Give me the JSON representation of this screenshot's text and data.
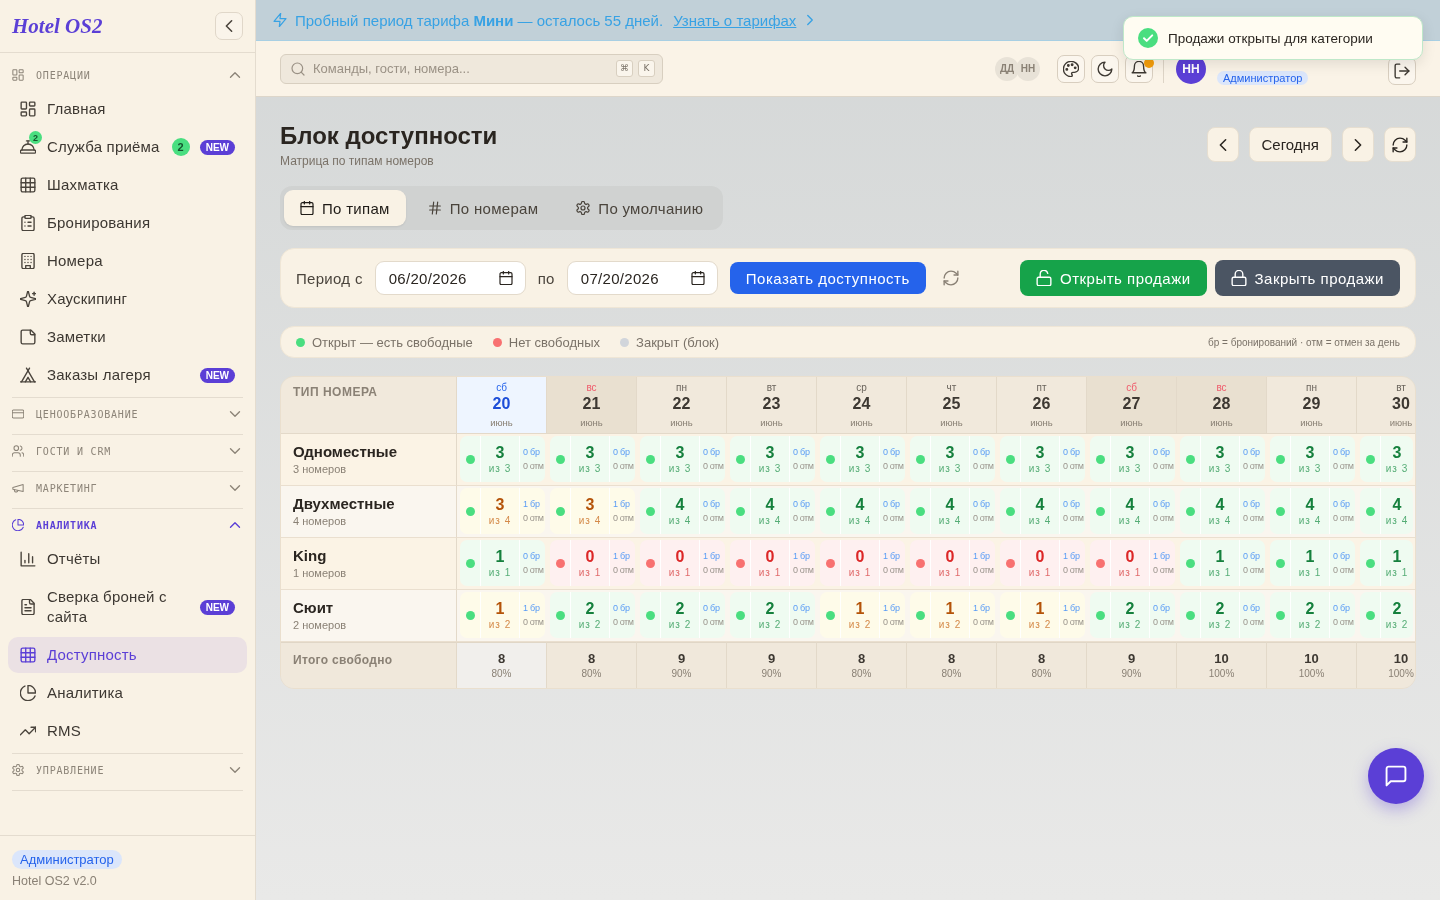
{
  "sidebar": {
    "logo": "Hotel OS2",
    "sections": [
      {
        "label": "ОПЕРАЦИИ",
        "expanded": true,
        "active": false,
        "items": [
          {
            "label": "Главная",
            "selected": false
          },
          {
            "label": "Служба приёма",
            "selected": false,
            "icon_badge": "2",
            "count": "2",
            "tag": "NEW"
          },
          {
            "label": "Шахматка",
            "selected": false
          },
          {
            "label": "Бронирования",
            "selected": false
          },
          {
            "label": "Номера",
            "selected": false
          },
          {
            "label": "Хаускипинг",
            "selected": false
          },
          {
            "label": "Заметки",
            "selected": false
          },
          {
            "label": "Заказы лагеря",
            "selected": false,
            "tag": "NEW"
          }
        ]
      },
      {
        "label": "ЦЕНООБРАЗОВАНИЕ",
        "expanded": false,
        "active": false
      },
      {
        "label": "ГОСТИ И CRM",
        "expanded": false,
        "active": false
      },
      {
        "label": "МАРКЕТИНГ",
        "expanded": false,
        "active": false
      },
      {
        "label": "АНАЛИТИКА",
        "expanded": true,
        "active": true,
        "items": [
          {
            "label": "Отчёты",
            "selected": false
          },
          {
            "label": "Сверка броней с сайта",
            "selected": false,
            "tag": "NEW"
          },
          {
            "label": "Доступность",
            "selected": true
          },
          {
            "label": "Аналитика",
            "selected": false
          },
          {
            "label": "RMS",
            "selected": false
          }
        ]
      },
      {
        "label": "УПРАВЛЕНИЕ",
        "expanded": false,
        "active": false
      }
    ],
    "footer": {
      "role": "Администратор",
      "version": "Hotel OS2 v2.0"
    }
  },
  "banner": {
    "text": "Пробный период тарифа **Мини** — осталось 55 дней.",
    "link": "Узнать о тарифах"
  },
  "topbar": {
    "search": {
      "placeholder": "Команды, гости, номера...",
      "shortcut": [
        "⌘",
        "K"
      ]
    },
    "online_users": [
      "ДД",
      "НН"
    ],
    "notifications": {
      "unread": true
    },
    "user": {
      "initials": "НН",
      "role": "Администратор"
    }
  },
  "toast": {
    "message": "Продажи открыты для категории"
  },
  "page": {
    "title": "Блок доступности",
    "subtitle": "Матрица по типам номеров",
    "today_button": "Сегодня"
  },
  "view_tabs": [
    {
      "label": "По типам",
      "selected": true
    },
    {
      "label": "По номерам",
      "selected": false
    },
    {
      "label": "По умолчанию",
      "selected": false
    }
  ],
  "filters": {
    "from_label": "Период с",
    "from": "06/20/2026",
    "to_label": "по",
    "to": "07/20/2026",
    "show_button": "Показать доступность",
    "actions": [
      {
        "kind": "open",
        "label": "Открыть продажи"
      },
      {
        "kind": "close",
        "label": "Закрыть продажи"
      }
    ]
  },
  "legend": {
    "items": [
      {
        "label": "Открыт — есть свободные",
        "color": "#4ade80"
      },
      {
        "label": "Нет свободных",
        "color": "#f87171"
      },
      {
        "label": "Закрыт (блок)",
        "color": "#d1d5db"
      }
    ],
    "note": "бр = бронирований · отм = отмен за день"
  },
  "table": {
    "type_header": "ТИП НОМЕРА",
    "columns": [
      {
        "weekday": "сб",
        "day": "20",
        "month": "июнь",
        "weekend": true,
        "today": true
      },
      {
        "weekday": "вс",
        "day": "21",
        "month": "июнь",
        "weekend": true,
        "today": false
      },
      {
        "weekday": "пн",
        "day": "22",
        "month": "июнь",
        "weekend": false,
        "today": false
      },
      {
        "weekday": "вт",
        "day": "23",
        "month": "июнь",
        "weekend": false,
        "today": false
      },
      {
        "weekday": "ср",
        "day": "24",
        "month": "июнь",
        "weekend": false,
        "today": false
      },
      {
        "weekday": "чт",
        "day": "25",
        "month": "июнь",
        "weekend": false,
        "today": false
      },
      {
        "weekday": "пт",
        "day": "26",
        "month": "июнь",
        "weekend": false,
        "today": false
      },
      {
        "weekday": "сб",
        "day": "27",
        "month": "июнь",
        "weekend": true,
        "today": false
      },
      {
        "weekday": "вс",
        "day": "28",
        "month": "июнь",
        "weekend": true,
        "today": false
      },
      {
        "weekday": "пн",
        "day": "29",
        "month": "июнь",
        "weekend": false,
        "today": false
      },
      {
        "weekday": "вт",
        "day": "30",
        "month": "июнь",
        "weekend": false,
        "today": false
      }
    ],
    "rows": [
      {
        "name": "Одноместные",
        "count": "3 номеров",
        "cells": [
          {
            "sold_out": false,
            "partly_booked": false,
            "free": "3",
            "total": "из 3",
            "booked": "0 бр",
            "cancelled": "0 отм"
          },
          {
            "sold_out": false,
            "partly_booked": false,
            "free": "3",
            "total": "из 3",
            "booked": "0 бр",
            "cancelled": "0 отм"
          },
          {
            "sold_out": false,
            "partly_booked": false,
            "free": "3",
            "total": "из 3",
            "booked": "0 бр",
            "cancelled": "0 отм"
          },
          {
            "sold_out": false,
            "partly_booked": false,
            "free": "3",
            "total": "из 3",
            "booked": "0 бр",
            "cancelled": "0 отм"
          },
          {
            "sold_out": false,
            "partly_booked": false,
            "free": "3",
            "total": "из 3",
            "booked": "0 бр",
            "cancelled": "0 отм"
          },
          {
            "sold_out": false,
            "partly_booked": false,
            "free": "3",
            "total": "из 3",
            "booked": "0 бр",
            "cancelled": "0 отм"
          },
          {
            "sold_out": false,
            "partly_booked": false,
            "free": "3",
            "total": "из 3",
            "booked": "0 бр",
            "cancelled": "0 отм"
          },
          {
            "sold_out": false,
            "partly_booked": false,
            "free": "3",
            "total": "из 3",
            "booked": "0 бр",
            "cancelled": "0 отм"
          },
          {
            "sold_out": false,
            "partly_booked": false,
            "free": "3",
            "total": "из 3",
            "booked": "0 бр",
            "cancelled": "0 отм"
          },
          {
            "sold_out": false,
            "partly_booked": false,
            "free": "3",
            "total": "из 3",
            "booked": "0 бр",
            "cancelled": "0 отм"
          },
          {
            "sold_out": false,
            "partly_booked": false,
            "free": "3",
            "total": "из 3"
          }
        ]
      },
      {
        "name": "Двухместные",
        "count": "4 номеров",
        "cells": [
          {
            "sold_out": false,
            "partly_booked": true,
            "free": "3",
            "total": "из 4",
            "booked": "1 бр",
            "cancelled": "0 отм"
          },
          {
            "sold_out": false,
            "partly_booked": true,
            "free": "3",
            "total": "из 4",
            "booked": "1 бр",
            "cancelled": "0 отм"
          },
          {
            "sold_out": false,
            "partly_booked": false,
            "free": "4",
            "total": "из 4",
            "booked": "0 бр",
            "cancelled": "0 отм"
          },
          {
            "sold_out": false,
            "partly_booked": false,
            "free": "4",
            "total": "из 4",
            "booked": "0 бр",
            "cancelled": "0 отм"
          },
          {
            "sold_out": false,
            "partly_booked": false,
            "free": "4",
            "total": "из 4",
            "booked": "0 бр",
            "cancelled": "0 отм"
          },
          {
            "sold_out": false,
            "partly_booked": false,
            "free": "4",
            "total": "из 4",
            "booked": "0 бр",
            "cancelled": "0 отм"
          },
          {
            "sold_out": false,
            "partly_booked": false,
            "free": "4",
            "total": "из 4",
            "booked": "0 бр",
            "cancelled": "0 отм"
          },
          {
            "sold_out": false,
            "partly_booked": false,
            "free": "4",
            "total": "из 4",
            "booked": "0 бр",
            "cancelled": "0 отм"
          },
          {
            "sold_out": false,
            "partly_booked": false,
            "free": "4",
            "total": "из 4",
            "booked": "0 бр",
            "cancelled": "0 отм"
          },
          {
            "sold_out": false,
            "partly_booked": false,
            "free": "4",
            "total": "из 4",
            "booked": "0 бр",
            "cancelled": "0 отм"
          },
          {
            "sold_out": false,
            "partly_booked": false,
            "free": "4",
            "total": "из 4"
          }
        ]
      },
      {
        "name": "King",
        "count": "1 номеров",
        "cells": [
          {
            "sold_out": false,
            "partly_booked": false,
            "free": "1",
            "total": "из 1",
            "booked": "0 бр",
            "cancelled": "0 отм"
          },
          {
            "sold_out": true,
            "partly_booked": false,
            "free": "0",
            "total": "из 1",
            "booked": "1 бр",
            "cancelled": "0 отм"
          },
          {
            "sold_out": true,
            "partly_booked": false,
            "free": "0",
            "total": "из 1",
            "booked": "1 бр",
            "cancelled": "0 отм"
          },
          {
            "sold_out": true,
            "partly_booked": false,
            "free": "0",
            "total": "из 1",
            "booked": "1 бр",
            "cancelled": "0 отм"
          },
          {
            "sold_out": true,
            "partly_booked": false,
            "free": "0",
            "total": "из 1",
            "booked": "1 бр",
            "cancelled": "0 отм"
          },
          {
            "sold_out": true,
            "partly_booked": false,
            "free": "0",
            "total": "из 1",
            "booked": "1 бр",
            "cancelled": "0 отм"
          },
          {
            "sold_out": true,
            "partly_booked": false,
            "free": "0",
            "total": "из 1",
            "booked": "1 бр",
            "cancelled": "0 отм"
          },
          {
            "sold_out": true,
            "partly_booked": false,
            "free": "0",
            "total": "из 1",
            "booked": "1 бр",
            "cancelled": "0 отм"
          },
          {
            "sold_out": false,
            "partly_booked": false,
            "free": "1",
            "total": "из 1",
            "booked": "0 бр",
            "cancelled": "0 отм"
          },
          {
            "sold_out": false,
            "partly_booked": false,
            "free": "1",
            "total": "из 1",
            "booked": "0 бр",
            "cancelled": "0 отм"
          },
          {
            "sold_out": false,
            "partly_booked": false,
            "free": "1",
            "total": "из 1"
          }
        ]
      },
      {
        "name": "Сюит",
        "count": "2 номеров",
        "cells": [
          {
            "sold_out": false,
            "partly_booked": true,
            "free": "1",
            "total": "из 2",
            "booked": "1 бр",
            "cancelled": "0 отм"
          },
          {
            "sold_out": false,
            "partly_booked": false,
            "free": "2",
            "total": "из 2",
            "booked": "0 бр",
            "cancelled": "0 отм"
          },
          {
            "sold_out": false,
            "partly_booked": false,
            "free": "2",
            "total": "из 2",
            "booked": "0 бр",
            "cancelled": "0 отм"
          },
          {
            "sold_out": false,
            "partly_booked": false,
            "free": "2",
            "total": "из 2",
            "booked": "0 бр",
            "cancelled": "0 отм"
          },
          {
            "sold_out": false,
            "partly_booked": true,
            "free": "1",
            "total": "из 2",
            "booked": "1 бр",
            "cancelled": "0 отм"
          },
          {
            "sold_out": false,
            "partly_booked": true,
            "free": "1",
            "total": "из 2",
            "booked": "1 бр",
            "cancelled": "0 отм"
          },
          {
            "sold_out": false,
            "partly_booked": true,
            "free": "1",
            "total": "из 2",
            "booked": "1 бр",
            "cancelled": "0 отм"
          },
          {
            "sold_out": false,
            "partly_booked": false,
            "free": "2",
            "total": "из 2",
            "booked": "0 бр",
            "cancelled": "0 отм"
          },
          {
            "sold_out": false,
            "partly_booked": false,
            "free": "2",
            "total": "из 2",
            "booked": "0 бр",
            "cancelled": "0 отм"
          },
          {
            "sold_out": false,
            "partly_booked": false,
            "free": "2",
            "total": "из 2",
            "booked": "0 бр",
            "cancelled": "0 отм"
          },
          {
            "sold_out": false,
            "partly_booked": false,
            "free": "2",
            "total": "из 2"
          }
        ]
      }
    ],
    "total_label": "Итого свободно",
    "totals": [
      {
        "free": "8",
        "percent": "80%"
      },
      {
        "free": "8",
        "percent": "80%"
      },
      {
        "free": "9",
        "percent": "90%"
      },
      {
        "free": "9",
        "percent": "90%"
      },
      {
        "free": "8",
        "percent": "80%"
      },
      {
        "free": "8",
        "percent": "80%"
      },
      {
        "free": "8",
        "percent": "80%"
      },
      {
        "free": "9",
        "percent": "90%"
      },
      {
        "free": "10",
        "percent": "100%"
      },
      {
        "free": "10",
        "percent": "100%"
      },
      {
        "free": "10",
        "percent": "100%"
      }
    ]
  }
}
